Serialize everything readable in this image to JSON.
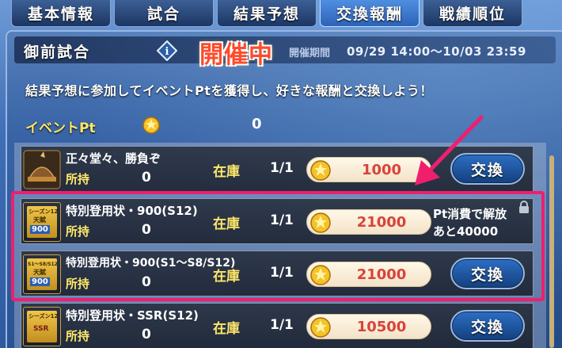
{
  "tabs": [
    {
      "label": "基本情報"
    },
    {
      "label": "試合"
    },
    {
      "label": "結果予想"
    },
    {
      "label": "交換報酬",
      "active": true
    },
    {
      "label": "戦績順位"
    }
  ],
  "event": {
    "title": "御前試合",
    "status": "開催中",
    "period_label": "開催期間",
    "period_value": "09/29 14:00〜10/03 23:59"
  },
  "description": "結果予想に参加してイベントPtを獲得し、好きな報酬と交換しよう！",
  "points": {
    "label": "イベントPt",
    "value": "0"
  },
  "items": [
    {
      "name": "正々堂々、勝負ぞ",
      "own_label": "所持",
      "own": "0",
      "stock_label": "在庫",
      "stock": "1/1",
      "price": "1000",
      "action": "交換",
      "thumb_icon": "helmet-icon"
    },
    {
      "name": "特別登用状・900(S12)",
      "own_label": "所持",
      "own": "0",
      "stock_label": "在庫",
      "stock": "1/1",
      "price": "21000",
      "locked_text_1": "Pt消費で解放",
      "locked_text_2": "あと40000",
      "thumb_icon": "ticket-icon",
      "thumb_text_1": "シーズン12",
      "thumb_text_2": "天賦",
      "thumb_text_3": "900"
    },
    {
      "name": "特別登用状・900(S1〜S8/S12)",
      "own_label": "所持",
      "own": "0",
      "stock_label": "在庫",
      "stock": "1/1",
      "price": "21000",
      "action": "交換",
      "thumb_icon": "ticket-icon",
      "thumb_text_1": "S1〜S8/S12",
      "thumb_text_2": "天賦",
      "thumb_text_3": "900"
    },
    {
      "name": "特別登用状・SSR(S12)",
      "own_label": "所持",
      "own": "0",
      "stock_label": "在庫",
      "stock": "1/1",
      "price": "10500",
      "action": "交換",
      "thumb_icon": "ticket-icon",
      "thumb_text_1": "シーズン12",
      "thumb_text_2": "SSR"
    }
  ],
  "colors": {
    "highlight": "#ef1f6e",
    "price_text": "#d8433a",
    "label_gold": "#ffe86a",
    "status_red": "#ff4a2b"
  }
}
